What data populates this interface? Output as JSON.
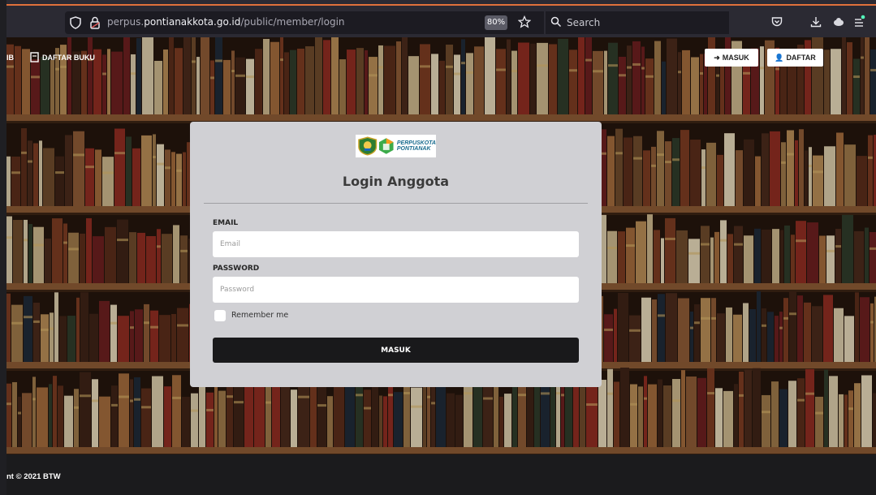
{
  "browser": {
    "url_prefix": "perpus.",
    "url_host": "pontianakkota.go.id",
    "url_path": "/public/member/login",
    "zoom": "80%",
    "search_placeholder": "Search"
  },
  "nav": {
    "left_fragment": "IB",
    "daftar_buku": "DAFTAR BUKU",
    "masuk": "MASUK",
    "daftar": "DAFTAR"
  },
  "login": {
    "logo_line1": "PERPUSKOTA",
    "logo_line2": "PONTIANAK",
    "title": "Login Anggota",
    "email_label": "EMAIL",
    "email_placeholder": "Email",
    "password_label": "PASSWORD",
    "password_placeholder": "Password",
    "remember_label": "Remember me",
    "submit_label": "MASUK"
  },
  "footer": {
    "text": "nt © 2021 BTW"
  },
  "colors": {
    "browser_accent": "#e0713b",
    "button_dark": "#19191b",
    "card_bg": "#d0d0d4",
    "logo_teal": "#1a6c8f"
  }
}
